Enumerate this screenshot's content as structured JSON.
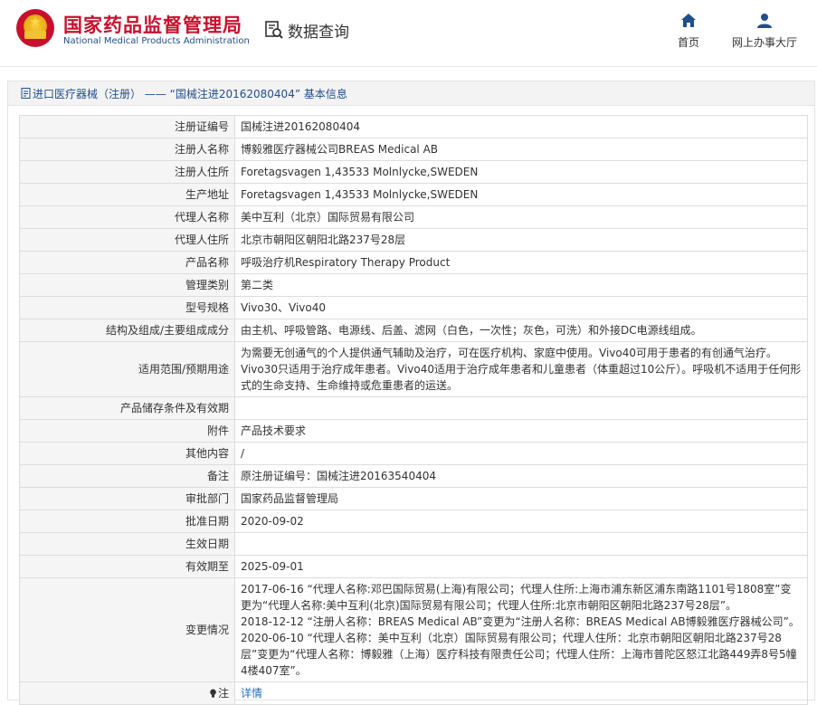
{
  "header": {
    "org_name_cn": "国家药品监督管理局",
    "org_name_en": "National Medical Products Administration",
    "query_title": "数据查询",
    "nav": [
      {
        "label": "首页",
        "icon": "home-icon"
      },
      {
        "label": "网上办事大厅",
        "icon": "user-icon"
      }
    ]
  },
  "breadcrumb": {
    "text": "进口医疗器械（注册） —— “国械注进20162080404” 基本信息",
    "icon": "document-icon"
  },
  "colors": {
    "brand_red": "#c8102e",
    "brand_blue": "#1f4e8c",
    "link_blue": "#1f6fc0",
    "label_bg": "#f5f5f5"
  },
  "details": {
    "rows": [
      {
        "label": "注册证编号",
        "value": "国械注进20162080404"
      },
      {
        "label": "注册人名称",
        "value": "博毅雅医疗器械公司BREAS Medical AB"
      },
      {
        "label": "注册人住所",
        "value": "Foretagsvagen 1,43533 Molnlycke,SWEDEN"
      },
      {
        "label": "生产地址",
        "value": "Foretagsvagen 1,43533 Molnlycke,SWEDEN"
      },
      {
        "label": "代理人名称",
        "value": "美中互利（北京）国际贸易有限公司"
      },
      {
        "label": "代理人住所",
        "value": "北京市朝阳区朝阳北路237号28层"
      },
      {
        "label": "产品名称",
        "value": "呼吸治疗机Respiratory Therapy Product"
      },
      {
        "label": "管理类别",
        "value": "第二类"
      },
      {
        "label": "型号规格",
        "value": "Vivo30、Vivo40"
      },
      {
        "label": "结构及组成/主要组成成分",
        "value": "由主机、呼吸管路、电源线、后盖、滤网（白色，一次性；灰色，可洗）和外接DC电源线组成。"
      },
      {
        "label": "适用范围/预期用途",
        "value": "为需要无创通气的个人提供通气辅助及治疗，可在医疗机构、家庭中使用。Vivo40可用于患者的有创通气治疗。Vivo30只适用于治疗成年患者。Vivo40适用于治疗成年患者和儿童患者（体重超过10公斤）。呼吸机不适用于任何形式的生命支持、生命维持或危重患者的运送。"
      },
      {
        "label": "产品储存条件及有效期",
        "value": ""
      },
      {
        "label": "附件",
        "value": "产品技术要求"
      },
      {
        "label": "其他内容",
        "value": "/"
      },
      {
        "label": "备注",
        "value": "原注册证编号：国械注进20163540404"
      },
      {
        "label": "审批部门",
        "value": "国家药品监督管理局"
      },
      {
        "label": "批准日期",
        "value": "2020-09-02"
      },
      {
        "label": "生效日期",
        "value": ""
      },
      {
        "label": "有效期至",
        "value": "2025-09-01"
      }
    ],
    "history": {
      "label": "变更情况",
      "entries": [
        "2017-06-16 “代理人名称:邓巴国际贸易(上海)有限公司；代理人住所:上海市浦东新区浦东南路1101号1808室”变更为“代理人名称:美中互利(北京)国际贸易有限公司；代理人住所:北京市朝阳区朝阳北路237号28层”。",
        "2018-12-12 “注册人名称：BREAS Medical AB”变更为“注册人名称：BREAS Medical AB博毅雅医疗器械公司”。",
        "2020-06-10 “代理人名称：美中互利（北京）国际贸易有限公司；代理人住所：北京市朝阳区朝阳北路237号28层”变更为“代理人名称：博毅雅（上海）医疗科技有限责任公司；代理人住所：上海市普陀区怒江北路449弄8号5幢4楼407室”。"
      ]
    },
    "note": {
      "label": "注",
      "value": "详情"
    }
  }
}
